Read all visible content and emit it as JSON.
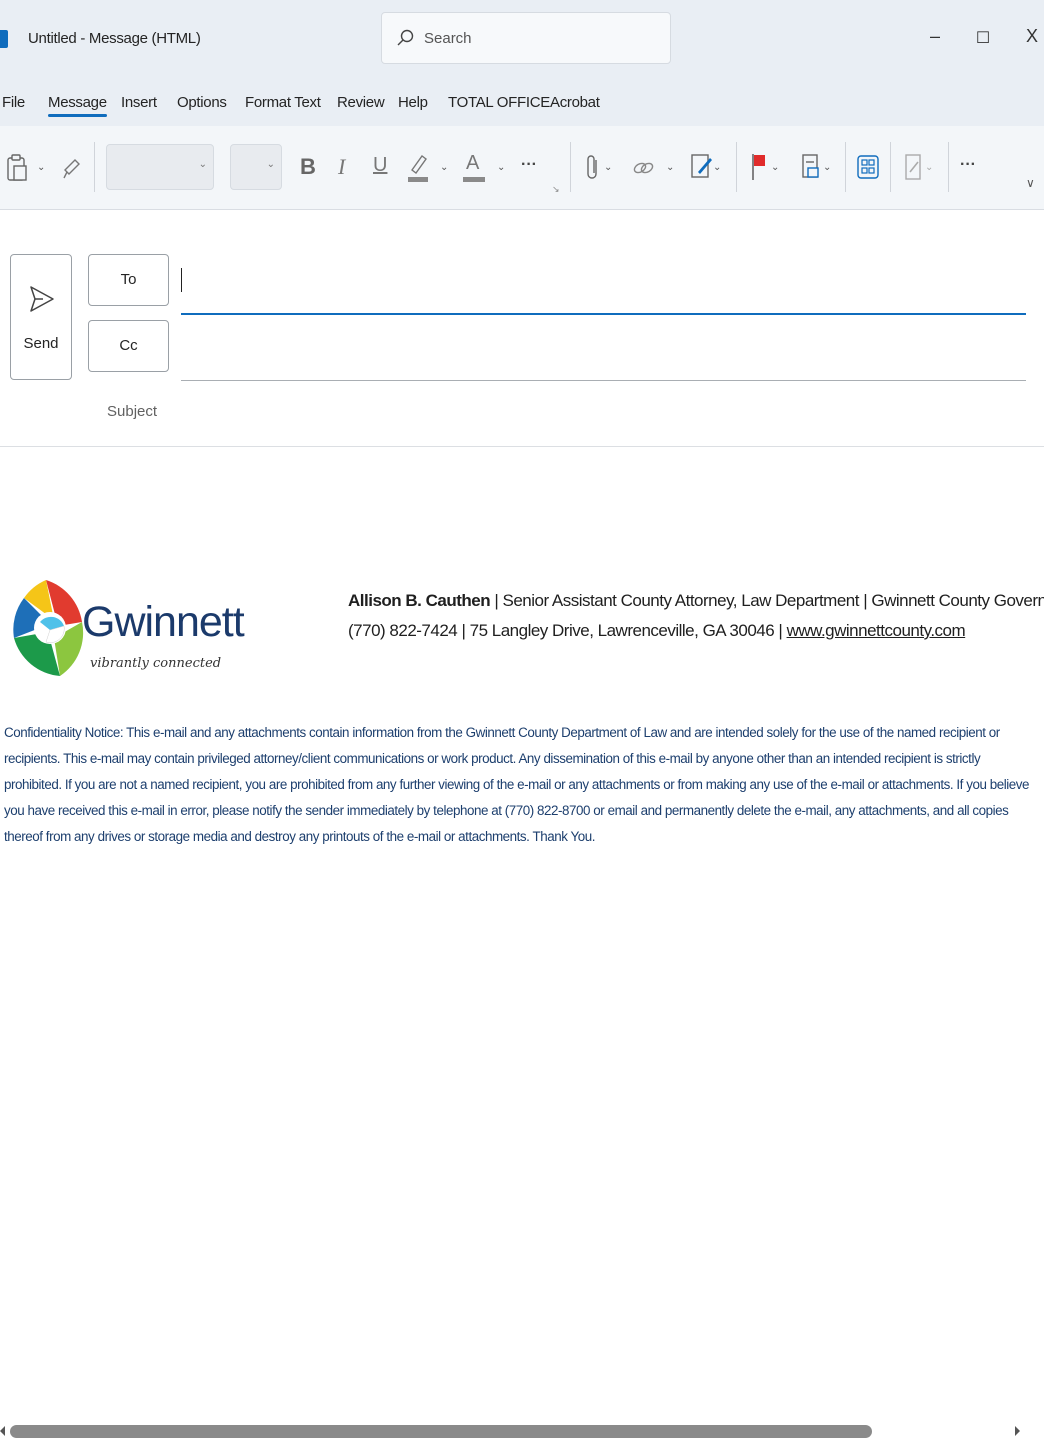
{
  "window": {
    "title": "Untitled  -  Message (HTML)",
    "app_icon": "outlook-icon",
    "search_placeholder": "Search",
    "minimize": "–",
    "maximize": "☐",
    "close": "X"
  },
  "menu": {
    "tabs": [
      {
        "label": "File"
      },
      {
        "label": "Message",
        "active": true
      },
      {
        "label": "Insert"
      },
      {
        "label": "Options"
      },
      {
        "label": "Format Text"
      },
      {
        "label": "Review"
      },
      {
        "label": "Help"
      },
      {
        "label": "TOTAL OFFICE"
      },
      {
        "label": "Acrobat"
      }
    ]
  },
  "ribbon": {
    "bold": "B",
    "italic": "I",
    "underline": "U",
    "font_color": "A",
    "more": "···",
    "more_end": "···",
    "collapse": "∨",
    "icons": [
      "paste-icon",
      "format-painter-icon",
      "highlight-icon",
      "attach-icon",
      "link-icon",
      "signature-icon",
      "flag-icon",
      "tag-icon",
      "apps-icon",
      "dictate-icon"
    ]
  },
  "compose": {
    "send_label": "Send",
    "to_label": "To",
    "cc_label": "Cc",
    "subject_label": "Subject",
    "to_value": "",
    "cc_value": ""
  },
  "signature": {
    "logo_word": "Gwinnett",
    "logo_tagline": "vibrantly connected",
    "name": "Allison B. Cauthen",
    "line1_rest": " | Senior Assistant County Attorney, Law Department | Gwinnett County Government",
    "line2_text": "(770) 822-7424 | 75 Langley Drive, Lawrenceville, GA  30046 | ",
    "website": "www.gwinnettcounty.com",
    "notice": "Confidentiality Notice:  This e-mail and any attachments contain information from the Gwinnett County Department of Law and are intended solely for the use of the named recipient or recipients. This e-mail may contain privileged attorney/client communications or work product. Any dissemination of this e-mail by anyone other than an intended recipient is strictly prohibited. If you are not a named recipient, you are prohibited from any further viewing of the e-mail or any attachments or from making any use of the e-mail or attachments. If you believe you have received this e-mail in error, please notify the sender immediately by telephone at (770) 822-8700 or email and permanently delete the e-mail, any attachments, and all copies thereof from any drives or storage media and destroy any printouts of the e-mail or attachments.  Thank You."
  },
  "colors": {
    "accent": "#0f6cbd",
    "notice_text": "#1d3f6e",
    "flag_red": "#e02b2b"
  }
}
